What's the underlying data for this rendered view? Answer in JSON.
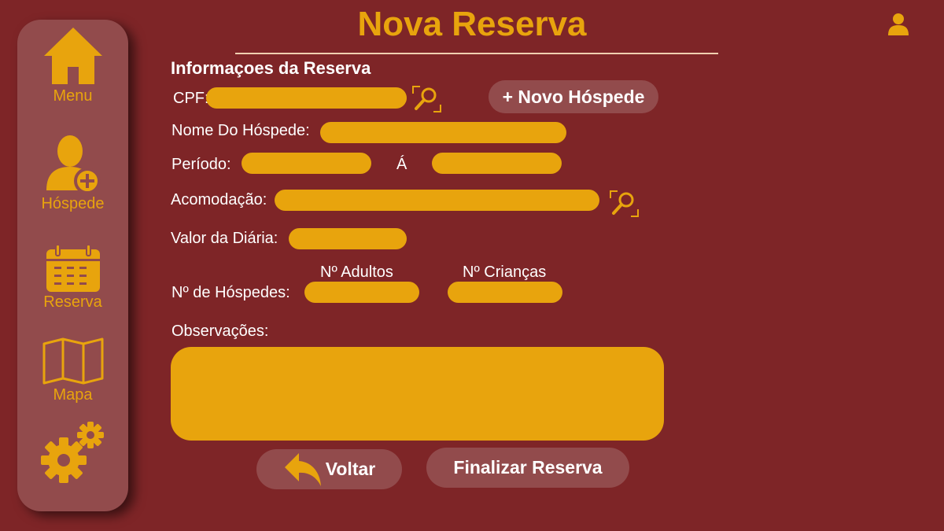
{
  "header": {
    "title": "Nova Reserva",
    "section_title": "Informaçoes da Reserva"
  },
  "sidebar": {
    "items": [
      {
        "label": "Menu",
        "icon": "home-icon"
      },
      {
        "label": "Hóspede",
        "icon": "add-user-icon"
      },
      {
        "label": "Reserva",
        "icon": "calendar-icon"
      },
      {
        "label": "Mapa",
        "icon": "map-icon"
      },
      {
        "label": "",
        "icon": "gears-icon"
      }
    ]
  },
  "form": {
    "cpf_label": "CPF:",
    "cpf_value": "",
    "new_guest_button": "+ Novo Hóspede",
    "guest_name_label": "Nome Do Hóspede:",
    "guest_name_value": "",
    "period_label": "Período:",
    "period_separator": "Á",
    "period_start": "",
    "period_end": "",
    "accommodation_label": "Acomodação:",
    "accommodation_value": "",
    "daily_rate_label": "Valor da Diária:",
    "daily_rate_value": "",
    "guests_label": "Nº de Hóspedes:",
    "adults_label": "Nº Adultos",
    "adults_value": "",
    "children_label": "Nº Crianças",
    "children_value": "",
    "notes_label": "Observações:",
    "notes_value": ""
  },
  "actions": {
    "back_label": "Voltar",
    "finish_label": "Finalizar Reserva"
  },
  "colors": {
    "background": "#7e2527",
    "panel": "#924b4c",
    "accent": "#e8a40d",
    "text": "#ffffff"
  }
}
